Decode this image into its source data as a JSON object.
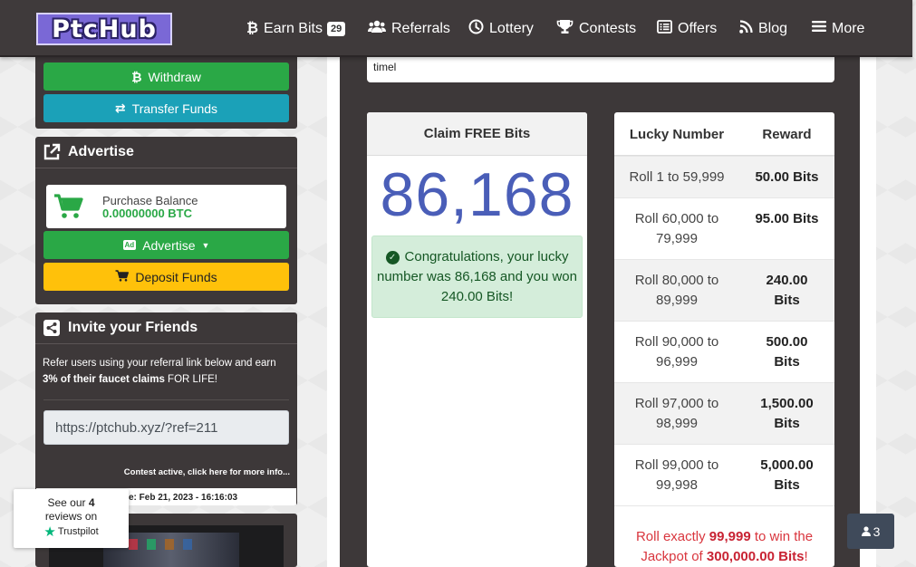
{
  "brand": {
    "logo_text": "PtcHub"
  },
  "nav": {
    "earn_bits": "Earn Bits",
    "earn_bits_badge": "29",
    "referrals": "Referrals",
    "lottery": "Lottery",
    "contests": "Contests",
    "offers": "Offers",
    "blog": "Blog",
    "more": "More"
  },
  "sidebar": {
    "withdraw": "Withdraw",
    "transfer": "Transfer Funds",
    "advertise": {
      "title": "Advertise",
      "balance_label": "Purchase Balance",
      "balance_value": "0.00000000 BTC",
      "advertise_button": "Advertise",
      "deposit_button": "Deposit Funds"
    },
    "invite": {
      "title": "Invite your Friends",
      "text_pre": "Refer users using your referral link below and earn ",
      "text_bold": "3% of their faucet claims",
      "text_post": " FOR LIFE!",
      "ref_link": "https://ptchub.xyz/?ref=211",
      "contest_link": "Contest active, click here for more info...",
      "date_text": "e: Feb 21, 2023 - 16:16:03"
    },
    "trustpilot": {
      "line1_pre": "See our ",
      "line1_bold": "4",
      "line2": "reviews on",
      "brand": "Trustpilot"
    }
  },
  "main": {
    "top_text": "timel",
    "claim": {
      "title": "Claim FREE Bits",
      "number": "86,168",
      "congrats": "Congratulations, your lucky number was 86,168 and you won 240.00 Bits!"
    },
    "rewards": {
      "col_lucky": "Lucky Number",
      "col_reward": "Reward",
      "rows": [
        {
          "range": "Roll 1 to 59,999",
          "reward": "50.00 Bits"
        },
        {
          "range": "Roll 60,000 to 79,999",
          "reward": "95.00 Bits"
        },
        {
          "range": "Roll 80,000 to 89,999",
          "reward": "240.00 Bits"
        },
        {
          "range": "Roll 90,000 to 96,999",
          "reward": "500.00 Bits"
        },
        {
          "range": "Roll 97,000 to 98,999",
          "reward": "1,500.00 Bits"
        },
        {
          "range": "Roll 99,000 to 99,998",
          "reward": "5,000.00 Bits"
        }
      ],
      "jackpot_pre": "Roll exactly ",
      "jackpot_number": "99,999",
      "jackpot_mid": " to win the Jackpot of ",
      "jackpot_amount": "300,000.00 Bits",
      "jackpot_post": "!"
    }
  },
  "online_count": "3",
  "colors": {
    "accent_green": "#2aa846",
    "accent_teal": "#1ba1b8",
    "accent_yellow": "#ffc10a",
    "number_blue": "#4a5eb8",
    "dark_panel": "#3d3839"
  }
}
